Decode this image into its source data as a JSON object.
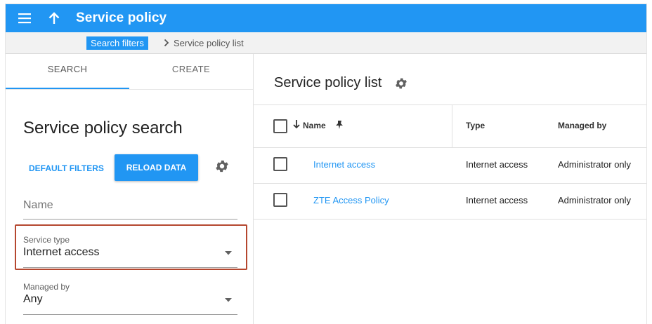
{
  "app_bar": {
    "title": "Service policy",
    "menu_icon": "menu-icon",
    "up_icon": "arrow-up-icon",
    "color": "#2196f3"
  },
  "breadcrumb": {
    "link": "Search filters",
    "current": "Service policy list"
  },
  "left_panel": {
    "tabs": [
      {
        "label": "SEARCH",
        "active": true
      },
      {
        "label": "CREATE",
        "active": false
      }
    ],
    "title": "Service policy search",
    "default_filters_label": "DEFAULT FILTERS",
    "reload_label": "RELOAD DATA",
    "fields": {
      "name": {
        "placeholder": "Name"
      },
      "service_type": {
        "label": "Service type",
        "value": "Internet access"
      },
      "managed_by": {
        "label": "Managed by",
        "value": "Any"
      }
    },
    "highlight_color": "#b5472f"
  },
  "right_panel": {
    "title": "Service policy list",
    "columns": [
      "Name",
      "Type",
      "Managed by"
    ],
    "rows": [
      {
        "name": "Internet access",
        "type": "Internet access",
        "managed_by": "Administrator only"
      },
      {
        "name": "ZTE Access Policy",
        "type": "Internet access",
        "managed_by": "Administrator only"
      }
    ]
  }
}
